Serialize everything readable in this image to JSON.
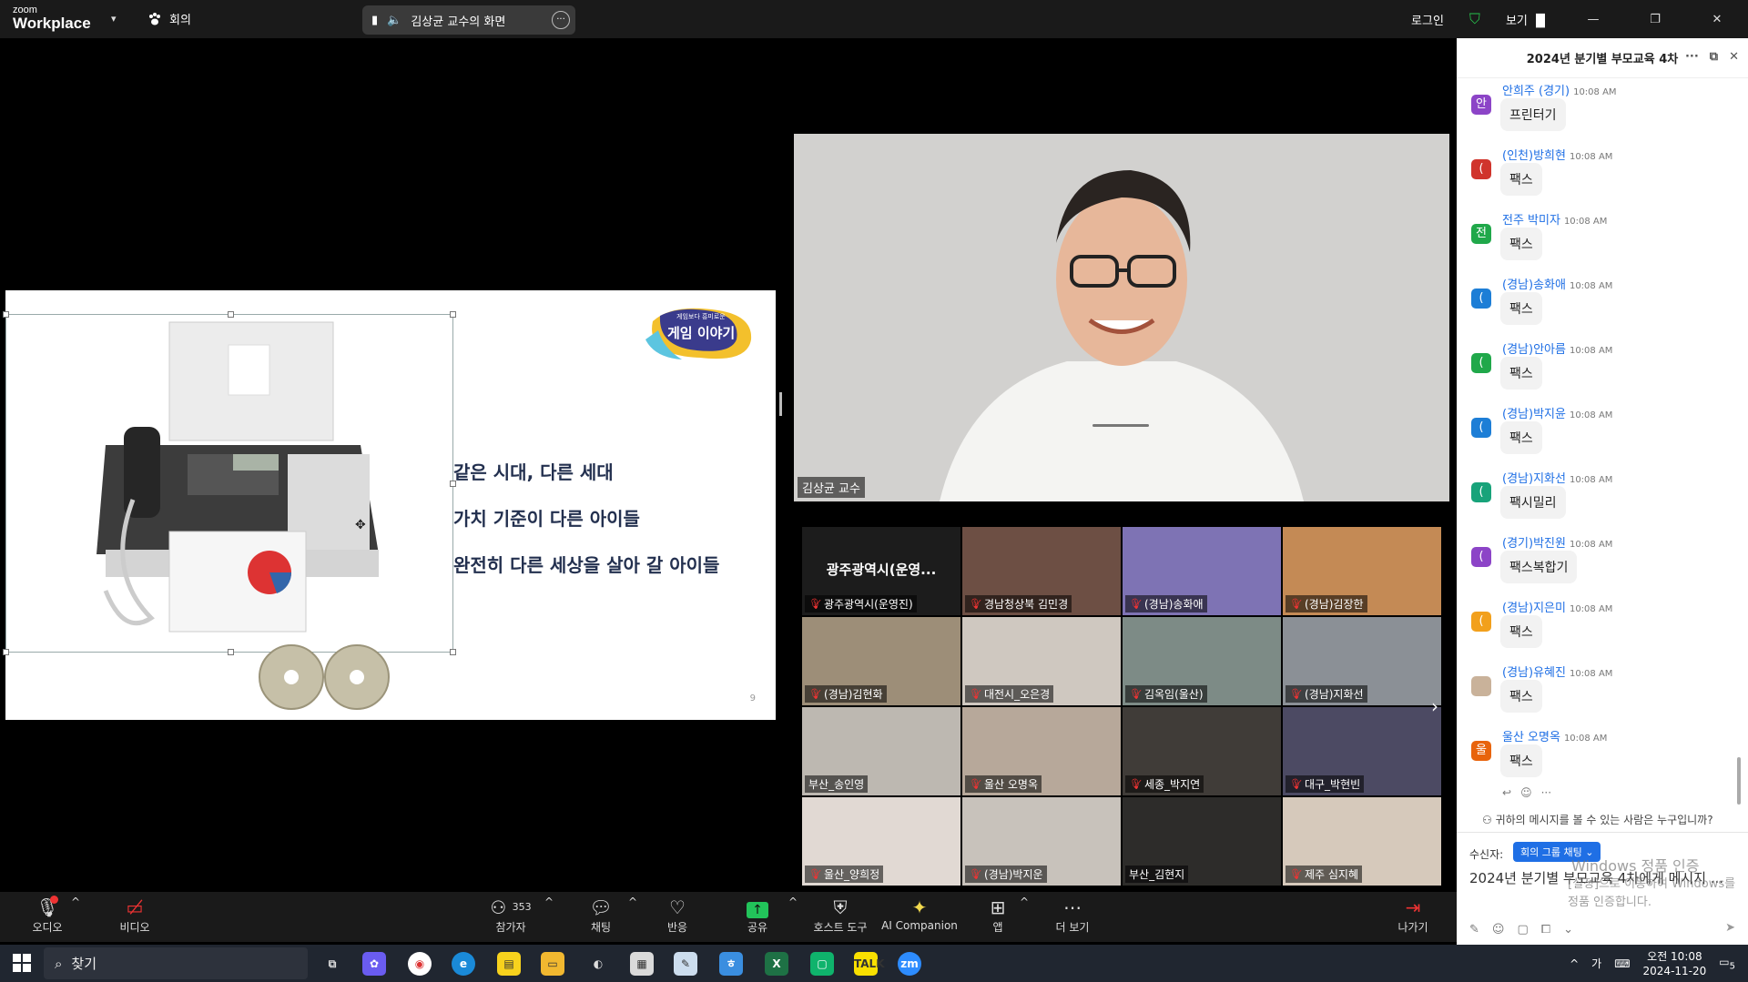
{
  "app": {
    "logo_small": "zoom",
    "logo_big": "Workplace",
    "meeting_label": "회의",
    "share_pill": "김상균 교수의 화면",
    "login": "로그인",
    "view": "보기"
  },
  "slide": {
    "lines": [
      "같은 시대, 다른 세대",
      "가치 기준이 다른 아이들",
      "완전히 다른 세상을 살아 갈 아이들"
    ],
    "logo_small": "게임보다 흥미로운",
    "logo_big": "게임 이야기",
    "page": "9"
  },
  "speaker": {
    "name": "김상균 교수"
  },
  "participants": [
    {
      "name": "광주광역시(운영진)",
      "big": "광주광역시(운영...",
      "bg": "#1c1c1c"
    },
    {
      "name": "경남청상북 김민경",
      "bg": "#6d4f44"
    },
    {
      "name": "(경남)송화애",
      "bg": "#7e73b4"
    },
    {
      "name": "(경남)김장한",
      "bg": "#c48a55"
    },
    {
      "name": "(경남)김현화",
      "bg": "#9d8e78"
    },
    {
      "name": "대전시_오은경",
      "bg": "#cfc8c0"
    },
    {
      "name": "김옥임(울산)",
      "bg": "#7d8b86"
    },
    {
      "name": "(경남)지화선",
      "bg": "#8b9096"
    },
    {
      "name": "부산_송인영",
      "bg": "#bdb8b1"
    },
    {
      "name": "울산 오명옥",
      "bg": "#b7a89a"
    },
    {
      "name": "세종_박지연",
      "bg": "#403c38"
    },
    {
      "name": "대구_박현빈",
      "bg": "#4c4a63"
    },
    {
      "name": "울산_양희정",
      "bg": "#e1d9d3"
    },
    {
      "name": "(경남)박지운",
      "bg": "#c8c2bb"
    },
    {
      "name": "부산_김현지",
      "bg": "#2d2c2a"
    },
    {
      "name": "제주 심지혜",
      "bg": "#d6c9bb"
    }
  ],
  "toolbar": {
    "audio": "오디오",
    "video": "비디오",
    "participants": "참가자",
    "participants_count": "353",
    "chat": "채팅",
    "react": "반응",
    "share": "공유",
    "host_tools": "호스트 도구",
    "ai": "AI Companion",
    "apps": "앱",
    "more": "더 보기",
    "leave": "나가기"
  },
  "chat": {
    "title": "2024년 분기별 부모교육 4차",
    "messages": [
      {
        "sender": "안희주 (경기)",
        "time": "10:08 AM",
        "text": "프린터기",
        "avatar": "안",
        "color": "#8c44c7"
      },
      {
        "sender": "(인천)방희현",
        "time": "10:08 AM",
        "text": "팩스",
        "avatar": "(",
        "color": "#d0342c"
      },
      {
        "sender": "전주 박미자",
        "time": "10:08 AM",
        "text": "팩스",
        "avatar": "전",
        "color": "#20a84a"
      },
      {
        "sender": "(경남)송화애",
        "time": "10:08 AM",
        "text": "팩스",
        "avatar": "(",
        "color": "#1d7ed6"
      },
      {
        "sender": "(경남)안아름",
        "time": "10:08 AM",
        "text": "팩스",
        "avatar": "(",
        "color": "#20a84a"
      },
      {
        "sender": "(경남)박지윤",
        "time": "10:08 AM",
        "text": "팩스",
        "avatar": "(",
        "color": "#1d7ed6"
      },
      {
        "sender": "(경남)지화선",
        "time": "10:08 AM",
        "text": "팩시밀리",
        "avatar": "(",
        "color": "#18a37a"
      },
      {
        "sender": "(경기)박진원",
        "time": "10:08 AM",
        "text": "팩스복합기",
        "avatar": "(",
        "color": "#8c44c7"
      },
      {
        "sender": "(경남)지은미",
        "time": "10:08 AM",
        "text": "팩스",
        "avatar": "(",
        "color": "#f2a01c"
      },
      {
        "sender": "(경남)유혜진",
        "time": "10:08 AM",
        "text": "팩스",
        "avatar": "",
        "color": "#c9b29a"
      },
      {
        "sender": "울산 오명옥",
        "time": "10:08 AM",
        "text": "팩스",
        "avatar": "울",
        "color": "#e8640c"
      }
    ],
    "who_sees": "귀하의 메시지를 볼 수 있는 사람은 누구입니까?",
    "recipient_label": "수신자:",
    "recipient": "회의 그룹 채팅",
    "compose": "2024년 분기별 부모교육 4차에게 메시지 ...",
    "watermark_line1": "Windows 정품 인증",
    "watermark_line2": "[설정]으로 이동하여 Windows를 정품 인증합니다."
  },
  "taskbar": {
    "search": "찾기",
    "ime": "가",
    "time": "오전 10:08",
    "date": "2024-11-20",
    "notif": "5"
  }
}
